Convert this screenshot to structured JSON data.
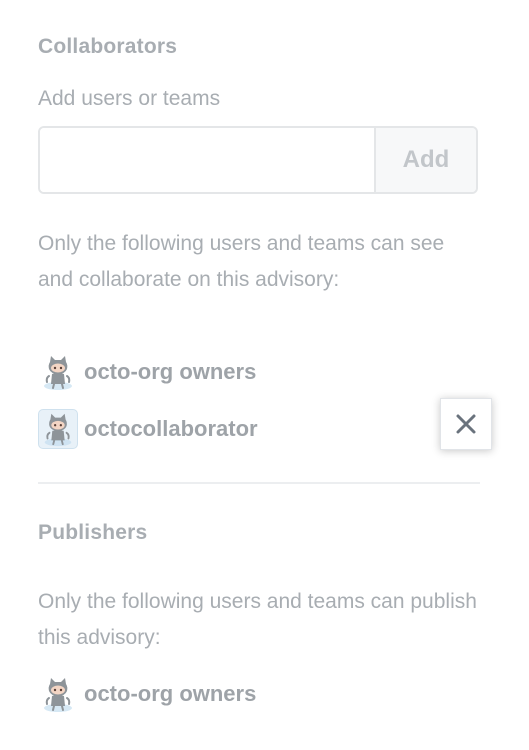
{
  "collaborators": {
    "heading": "Collaborators",
    "add_label": "Add users or teams",
    "input_value": "",
    "input_placeholder": "",
    "add_button": "Add",
    "description": "Only the following users and teams can see and collaborate on this advisory:",
    "members": [
      {
        "name": "octo-org owners",
        "avatar": "octocat-avatar",
        "removable": false
      },
      {
        "name": "octocollaborator",
        "avatar": "octocat-avatar",
        "removable": true
      }
    ],
    "remove_icon": "close-icon"
  },
  "publishers": {
    "heading": "Publishers",
    "description": "Only the following users and teams can publish this advisory:",
    "members": [
      {
        "name": "octo-org owners",
        "avatar": "octocat-avatar"
      }
    ]
  },
  "colors": {
    "muted_text": "#a8adb2",
    "border": "#e4e6e8",
    "avatar_bg": "#e8f1f8"
  }
}
